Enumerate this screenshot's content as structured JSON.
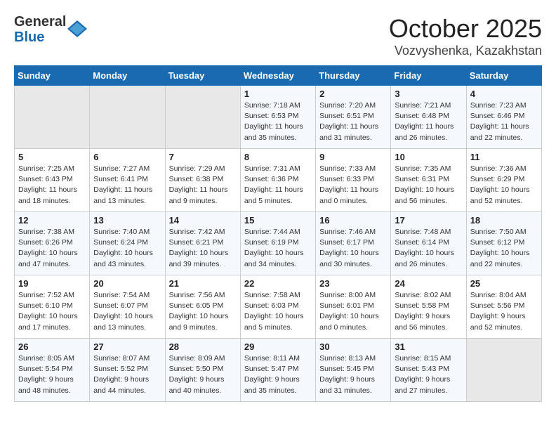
{
  "header": {
    "logo_general": "General",
    "logo_blue": "Blue",
    "month_title": "October 2025",
    "location": "Vozvyshenka, Kazakhstan"
  },
  "calendar": {
    "days_of_week": [
      "Sunday",
      "Monday",
      "Tuesday",
      "Wednesday",
      "Thursday",
      "Friday",
      "Saturday"
    ],
    "weeks": [
      [
        {
          "day": "",
          "empty": true
        },
        {
          "day": "",
          "empty": true
        },
        {
          "day": "",
          "empty": true
        },
        {
          "day": "1",
          "sunrise": "Sunrise: 7:18 AM",
          "sunset": "Sunset: 6:53 PM",
          "daylight": "Daylight: 11 hours and 35 minutes."
        },
        {
          "day": "2",
          "sunrise": "Sunrise: 7:20 AM",
          "sunset": "Sunset: 6:51 PM",
          "daylight": "Daylight: 11 hours and 31 minutes."
        },
        {
          "day": "3",
          "sunrise": "Sunrise: 7:21 AM",
          "sunset": "Sunset: 6:48 PM",
          "daylight": "Daylight: 11 hours and 26 minutes."
        },
        {
          "day": "4",
          "sunrise": "Sunrise: 7:23 AM",
          "sunset": "Sunset: 6:46 PM",
          "daylight": "Daylight: 11 hours and 22 minutes."
        }
      ],
      [
        {
          "day": "5",
          "sunrise": "Sunrise: 7:25 AM",
          "sunset": "Sunset: 6:43 PM",
          "daylight": "Daylight: 11 hours and 18 minutes."
        },
        {
          "day": "6",
          "sunrise": "Sunrise: 7:27 AM",
          "sunset": "Sunset: 6:41 PM",
          "daylight": "Daylight: 11 hours and 13 minutes."
        },
        {
          "day": "7",
          "sunrise": "Sunrise: 7:29 AM",
          "sunset": "Sunset: 6:38 PM",
          "daylight": "Daylight: 11 hours and 9 minutes."
        },
        {
          "day": "8",
          "sunrise": "Sunrise: 7:31 AM",
          "sunset": "Sunset: 6:36 PM",
          "daylight": "Daylight: 11 hours and 5 minutes."
        },
        {
          "day": "9",
          "sunrise": "Sunrise: 7:33 AM",
          "sunset": "Sunset: 6:33 PM",
          "daylight": "Daylight: 11 hours and 0 minutes."
        },
        {
          "day": "10",
          "sunrise": "Sunrise: 7:35 AM",
          "sunset": "Sunset: 6:31 PM",
          "daylight": "Daylight: 10 hours and 56 minutes."
        },
        {
          "day": "11",
          "sunrise": "Sunrise: 7:36 AM",
          "sunset": "Sunset: 6:29 PM",
          "daylight": "Daylight: 10 hours and 52 minutes."
        }
      ],
      [
        {
          "day": "12",
          "sunrise": "Sunrise: 7:38 AM",
          "sunset": "Sunset: 6:26 PM",
          "daylight": "Daylight: 10 hours and 47 minutes."
        },
        {
          "day": "13",
          "sunrise": "Sunrise: 7:40 AM",
          "sunset": "Sunset: 6:24 PM",
          "daylight": "Daylight: 10 hours and 43 minutes."
        },
        {
          "day": "14",
          "sunrise": "Sunrise: 7:42 AM",
          "sunset": "Sunset: 6:21 PM",
          "daylight": "Daylight: 10 hours and 39 minutes."
        },
        {
          "day": "15",
          "sunrise": "Sunrise: 7:44 AM",
          "sunset": "Sunset: 6:19 PM",
          "daylight": "Daylight: 10 hours and 34 minutes."
        },
        {
          "day": "16",
          "sunrise": "Sunrise: 7:46 AM",
          "sunset": "Sunset: 6:17 PM",
          "daylight": "Daylight: 10 hours and 30 minutes."
        },
        {
          "day": "17",
          "sunrise": "Sunrise: 7:48 AM",
          "sunset": "Sunset: 6:14 PM",
          "daylight": "Daylight: 10 hours and 26 minutes."
        },
        {
          "day": "18",
          "sunrise": "Sunrise: 7:50 AM",
          "sunset": "Sunset: 6:12 PM",
          "daylight": "Daylight: 10 hours and 22 minutes."
        }
      ],
      [
        {
          "day": "19",
          "sunrise": "Sunrise: 7:52 AM",
          "sunset": "Sunset: 6:10 PM",
          "daylight": "Daylight: 10 hours and 17 minutes."
        },
        {
          "day": "20",
          "sunrise": "Sunrise: 7:54 AM",
          "sunset": "Sunset: 6:07 PM",
          "daylight": "Daylight: 10 hours and 13 minutes."
        },
        {
          "day": "21",
          "sunrise": "Sunrise: 7:56 AM",
          "sunset": "Sunset: 6:05 PM",
          "daylight": "Daylight: 10 hours and 9 minutes."
        },
        {
          "day": "22",
          "sunrise": "Sunrise: 7:58 AM",
          "sunset": "Sunset: 6:03 PM",
          "daylight": "Daylight: 10 hours and 5 minutes."
        },
        {
          "day": "23",
          "sunrise": "Sunrise: 8:00 AM",
          "sunset": "Sunset: 6:01 PM",
          "daylight": "Daylight: 10 hours and 0 minutes."
        },
        {
          "day": "24",
          "sunrise": "Sunrise: 8:02 AM",
          "sunset": "Sunset: 5:58 PM",
          "daylight": "Daylight: 9 hours and 56 minutes."
        },
        {
          "day": "25",
          "sunrise": "Sunrise: 8:04 AM",
          "sunset": "Sunset: 5:56 PM",
          "daylight": "Daylight: 9 hours and 52 minutes."
        }
      ],
      [
        {
          "day": "26",
          "sunrise": "Sunrise: 8:05 AM",
          "sunset": "Sunset: 5:54 PM",
          "daylight": "Daylight: 9 hours and 48 minutes."
        },
        {
          "day": "27",
          "sunrise": "Sunrise: 8:07 AM",
          "sunset": "Sunset: 5:52 PM",
          "daylight": "Daylight: 9 hours and 44 minutes."
        },
        {
          "day": "28",
          "sunrise": "Sunrise: 8:09 AM",
          "sunset": "Sunset: 5:50 PM",
          "daylight": "Daylight: 9 hours and 40 minutes."
        },
        {
          "day": "29",
          "sunrise": "Sunrise: 8:11 AM",
          "sunset": "Sunset: 5:47 PM",
          "daylight": "Daylight: 9 hours and 35 minutes."
        },
        {
          "day": "30",
          "sunrise": "Sunrise: 8:13 AM",
          "sunset": "Sunset: 5:45 PM",
          "daylight": "Daylight: 9 hours and 31 minutes."
        },
        {
          "day": "31",
          "sunrise": "Sunrise: 8:15 AM",
          "sunset": "Sunset: 5:43 PM",
          "daylight": "Daylight: 9 hours and 27 minutes."
        },
        {
          "day": "",
          "empty": true
        }
      ]
    ]
  }
}
